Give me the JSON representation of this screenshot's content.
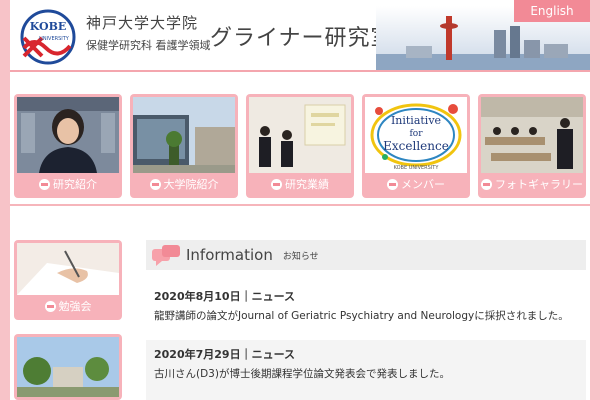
{
  "header": {
    "logo_top": "KOBE",
    "logo_bottom": "UNIVERSITY",
    "university": "神戸大学大学院",
    "department": "保健学研究科 看護学領域",
    "lab": "グライナー研究室",
    "lang_button": "English"
  },
  "nav": [
    {
      "label": "研究紹介"
    },
    {
      "label": "大学院紹介"
    },
    {
      "label": "研究業績"
    },
    {
      "label": "メンバー"
    },
    {
      "label": "フォトギャラリー"
    }
  ],
  "excellence": {
    "line1": "Initiative",
    "line2": "for",
    "line3": "Excellence",
    "caption": "KOBE UNIVERSITY"
  },
  "side": [
    {
      "label": "勉強会"
    }
  ],
  "info": {
    "title": "Information",
    "subtitle": "お知らせ",
    "items": [
      {
        "date": "2020年8月10日｜ニュース",
        "text": "龍野講師の論文がJournal of Geriatric Psychiatry and Neurologyに採択されました。"
      },
      {
        "date": "2020年7月29日｜ニュース",
        "text": "古川さん(D3)が博士後期課程学位論文発表会で発表しました。"
      }
    ]
  },
  "colors": {
    "accent": "#f28a96",
    "tile": "#f7b2ba",
    "background": "#f7c3c8"
  }
}
